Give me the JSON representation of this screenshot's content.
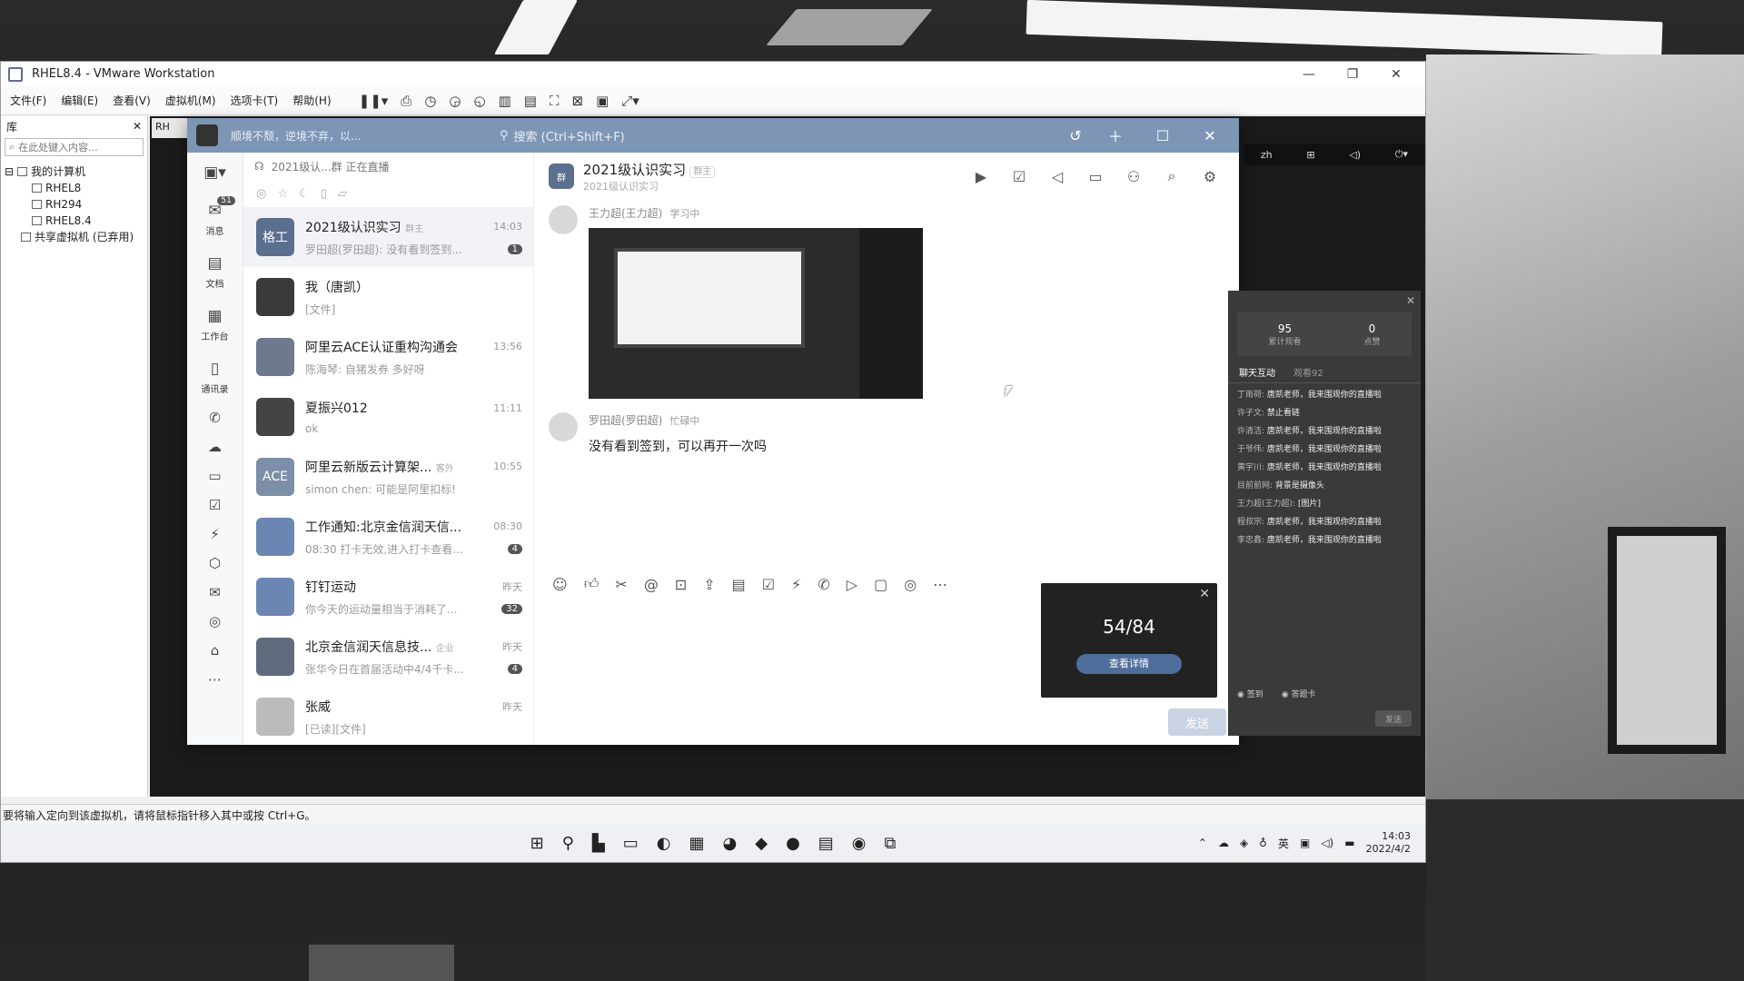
{
  "vmware": {
    "title": "RHEL8.4 - VMware Workstation",
    "menu": [
      "文件(F)",
      "编辑(E)",
      "查看(V)",
      "虚拟机(M)",
      "选项卡(T)",
      "帮助(H)"
    ],
    "library_label": "库",
    "library_search_placeholder": "在此处键入内容...",
    "tree": {
      "root": "我的计算机",
      "items": [
        "RHEL8",
        "RH294",
        "RHEL8.4"
      ],
      "shared": "共享虚拟机 (已弃用)"
    },
    "guest_tab": "RH",
    "guest_topbar": {
      "lang": "zh"
    },
    "status_text": "要将输入定向到该虚拟机，请将鼠标指针移入其中或按 Ctrl+G。"
  },
  "taskbar": {
    "ime": "英",
    "time": "14:03",
    "date": "2022/4/2"
  },
  "dingtalk": {
    "status_text": "顺境不颓，逆境不弃，以...",
    "search_placeholder": "搜索 (Ctrl+Shift+F)",
    "nav": [
      {
        "label": "消息",
        "badge": "51"
      },
      {
        "label": "文档",
        "badge": ""
      },
      {
        "label": "工作台",
        "badge": ""
      },
      {
        "label": "通讯录",
        "badge": ""
      }
    ],
    "list_header": "2021级认...群 正在直播",
    "conversations": [
      {
        "name": "2021级认识实习",
        "tag": "群主",
        "time": "14:03",
        "msg": "罗田超(罗田超): 没有看到签到...",
        "badge": "1",
        "avatar": "格工",
        "color": "#5b6f8f"
      },
      {
        "name": "我（唐凯）",
        "tag": "",
        "time": "",
        "msg": "[文件]",
        "badge": "",
        "avatar": "",
        "color": "#3a3a3a"
      },
      {
        "name": "阿里云ACE认证重构沟通会",
        "tag": "",
        "time": "13:56",
        "msg": "陈海琴: 自猪发券 多好呀",
        "badge": "",
        "avatar": "",
        "color": "#6d7a8e"
      },
      {
        "name": "夏振兴012",
        "tag": "",
        "time": "11:11",
        "msg": "ok",
        "badge": "",
        "avatar": "",
        "color": "#444"
      },
      {
        "name": "阿里云新版云计算架...",
        "tag": "客外",
        "time": "10:55",
        "msg": "simon chen: 可能是阿里扣标!",
        "badge": "",
        "avatar": "ACE",
        "color": "#7c8ea8"
      },
      {
        "name": "工作通知:北京金信润天信...",
        "tag": "",
        "time": "08:30",
        "msg": "08:30 打卡无效,进入打卡查看...",
        "badge": "4",
        "avatar": "",
        "color": "#6b86b3"
      },
      {
        "name": "钉钉运动",
        "tag": "",
        "time": "昨天",
        "msg": "你今天的运动量相当于消耗了...",
        "badge": "32",
        "avatar": "",
        "color": "#6b86b3"
      },
      {
        "name": "北京金信润天信息技...",
        "tag": "企业",
        "time": "昨天",
        "msg": "张华今日在首届活动中4/4千卡...",
        "badge": "4",
        "avatar": "",
        "color": "#5e6b7c"
      },
      {
        "name": "张威",
        "tag": "",
        "time": "昨天",
        "msg": "[已读][文件]",
        "badge": "",
        "avatar": "",
        "color": "#bbb"
      }
    ],
    "chat": {
      "group_name": "2021级认识实习",
      "group_tag": "群主",
      "group_sub": "2021级认识实习",
      "messages": [
        {
          "sender": "王力超(王力超)",
          "status": "学习中",
          "type": "image"
        },
        {
          "sender": "罗田超(罗田超)",
          "status": "忙碌中",
          "type": "text",
          "text": "没有看到签到，可以再开一次吗"
        }
      ],
      "send_label": "发送"
    },
    "signin_card": {
      "count": "54/84",
      "button": "查看详情"
    }
  },
  "live_panel": {
    "views": "95",
    "views_label": "累计观看",
    "likes": "0",
    "likes_label": "点赞",
    "tab_interaction": "聊天互动",
    "tab_viewers": "观看92",
    "comments": [
      {
        "user": "丁雨荷:",
        "text": "唐凯老师，我来围观你的直播啦"
      },
      {
        "user": "许子文:",
        "text": "禁止看链"
      },
      {
        "user": "许清洁:",
        "text": "唐凯老师，我来围观你的直播啦"
      },
      {
        "user": "于爷伟:",
        "text": "唐凯老师，我来围观你的直播啦"
      },
      {
        "user": "黄宇川:",
        "text": "唐凯老师，我来围观你的直播啦"
      },
      {
        "user": "目前前网:",
        "text": "背景是摄像头"
      },
      {
        "user": "王力超(王力超):",
        "text": "[图片]"
      },
      {
        "user": "程叔宗:",
        "text": "唐凯老师，我来围观你的直播啦"
      },
      {
        "user": "李忠鑫:",
        "text": "唐凯老师，我来围观你的直播啦"
      }
    ],
    "radio_a": "签到",
    "radio_b": "答题卡",
    "send": "发送"
  }
}
